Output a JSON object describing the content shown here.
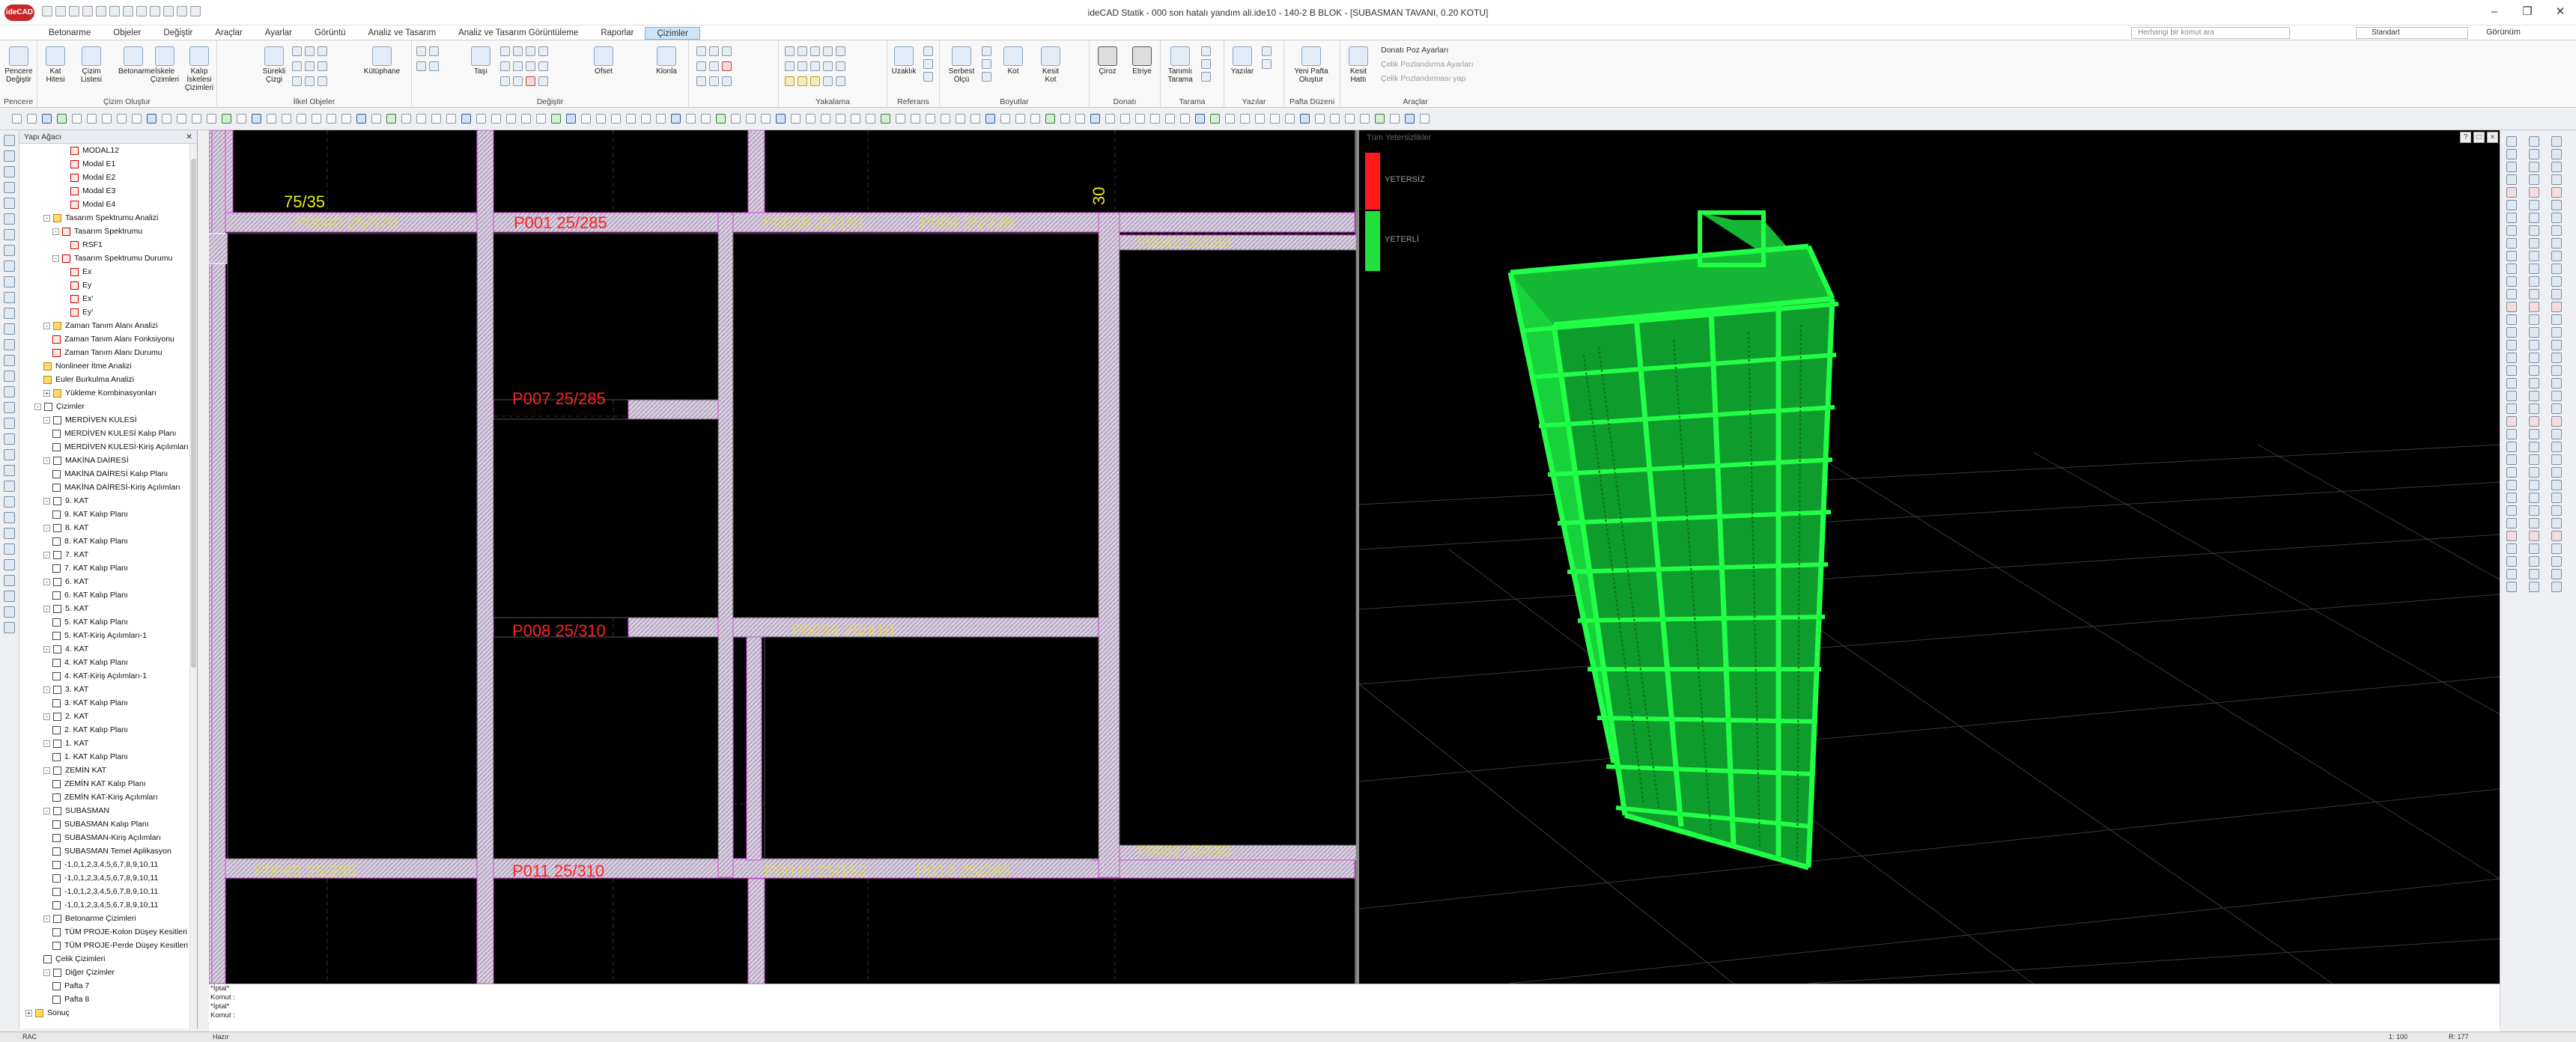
{
  "app": {
    "title": "ideCAD Statik - 000 son hatalı yandım ali.ide10 - 140-2 B BLOK - [SUBASMAN TAVANI,  0.20 KOTU]",
    "logo": "ideCAD"
  },
  "menus": [
    "Betonarme",
    "Objeler",
    "Değiştir",
    "Araçlar",
    "Ayarlar",
    "Görüntü",
    "Analiz ve Tasarım",
    "Analiz ve Tasarım Görüntüleme",
    "Raporlar",
    "Çizimler"
  ],
  "active_menu": "Çizimler",
  "search_placeholder": "Herhangi bir komut ara",
  "style_select": "Standart",
  "view_label": "Görünüm",
  "ribbon": {
    "groups": [
      {
        "title": "Pencere",
        "buttons": [
          "Pencere Değiştir"
        ]
      },
      {
        "title": "Çizim Oluştur",
        "buttons": [
          "Kat Hitesi",
          "Çizim Listesi",
          "Betonarme",
          "İskele Çizimleri",
          "Kalıp İskelesi Çizimleri"
        ]
      },
      {
        "title": "İlkel Objeler",
        "buttons": [
          "Sürekli Çizgi",
          "Kütüphane"
        ]
      },
      {
        "title": "Değiştir",
        "buttons": [
          "Taşı",
          "Ofset",
          "Klonla"
        ]
      },
      {
        "title": "Yakalama",
        "buttons": []
      },
      {
        "title": "Referans",
        "buttons": [
          "Uzaklık"
        ]
      },
      {
        "title": "Boyutlar",
        "buttons": [
          "Serbest Ölçü",
          "Kot",
          "Kesit Kot"
        ]
      },
      {
        "title": "Donatı",
        "buttons": [
          "Çiroz",
          "Etriye"
        ]
      },
      {
        "title": "Tarama",
        "buttons": [
          "Tanımlı Tarama"
        ]
      },
      {
        "title": "Yazılar",
        "buttons": [
          "Yazılar"
        ]
      },
      {
        "title": "Pafta Düzeni",
        "buttons": [
          "Yeni Pafta Oluştur"
        ]
      },
      {
        "title": "Araçlar",
        "buttons": [
          "Kesit Hattı"
        ]
      }
    ],
    "tools_list": [
      "Donatı Poz Ayarları",
      "Çelik Pozlandırma Ayarları",
      "Çelik Pozlandırması yap"
    ]
  },
  "tree": {
    "header": "Yapı Ağacı",
    "items": [
      {
        "label": "MODAL12",
        "level": 5,
        "icon": "red"
      },
      {
        "label": "Modal E1",
        "level": 5,
        "icon": "red"
      },
      {
        "label": "Modal E2",
        "level": 5,
        "icon": "red"
      },
      {
        "label": "Modal E3",
        "level": 5,
        "icon": "red"
      },
      {
        "label": "Modal E4",
        "level": 5,
        "icon": "red"
      },
      {
        "label": "Tasarım Spektrumu Analizi",
        "level": 2,
        "icon": "folder",
        "exp": "-"
      },
      {
        "label": "Tasarım Spektrumu",
        "level": 3,
        "icon": "red",
        "exp": "-"
      },
      {
        "label": "RSF1",
        "level": 5,
        "icon": "red"
      },
      {
        "label": "Tasarım Spektrumu Durumu",
        "level": 3,
        "icon": "red",
        "exp": "-"
      },
      {
        "label": "Ex",
        "level": 5,
        "icon": "red"
      },
      {
        "label": "Ey",
        "level": 5,
        "icon": "red"
      },
      {
        "label": "Ex'",
        "level": 5,
        "icon": "red"
      },
      {
        "label": "Ey'",
        "level": 5,
        "icon": "red"
      },
      {
        "label": "Zaman Tanım Alanı Analizi",
        "level": 2,
        "icon": "folder",
        "exp": "-"
      },
      {
        "label": "Zaman Tanım Alanı Fonksiyonu",
        "level": 3,
        "icon": "red"
      },
      {
        "label": "Zaman Tanım Alanı Durumu",
        "level": 3,
        "icon": "red"
      },
      {
        "label": "Nonlineer İtme Analizi",
        "level": 2,
        "icon": "folder"
      },
      {
        "label": "Euler Burkulma Analizi",
        "level": 2,
        "icon": "folder"
      },
      {
        "label": "Yükleme Kombinasyonları",
        "level": 2,
        "icon": "folder",
        "exp": "+"
      },
      {
        "label": "Çizimler",
        "level": 1,
        "icon": "doc",
        "exp": "-"
      },
      {
        "label": "MERDİVEN KULESİ",
        "level": 2,
        "icon": "doc",
        "exp": "-"
      },
      {
        "label": "MERDİVEN KULESİ Kalıp Planı",
        "level": 3,
        "icon": "doc"
      },
      {
        "label": "MERDİVEN KULESİ-Kiriş Açılımları",
        "level": 3,
        "icon": "doc"
      },
      {
        "label": "MAKİNA DAİRESİ",
        "level": 2,
        "icon": "doc",
        "exp": "-"
      },
      {
        "label": "MAKİNA DAİRESİ Kalıp Planı",
        "level": 3,
        "icon": "doc"
      },
      {
        "label": "MAKİNA DAİRESİ-Kiriş Açılımları",
        "level": 3,
        "icon": "doc"
      },
      {
        "label": "9. KAT",
        "level": 2,
        "icon": "doc",
        "exp": "-"
      },
      {
        "label": "9. KAT Kalıp Planı",
        "level": 3,
        "icon": "doc"
      },
      {
        "label": "8. KAT",
        "level": 2,
        "icon": "doc",
        "exp": "-"
      },
      {
        "label": "8. KAT Kalıp Planı",
        "level": 3,
        "icon": "doc"
      },
      {
        "label": "7. KAT",
        "level": 2,
        "icon": "doc",
        "exp": "-"
      },
      {
        "label": "7. KAT Kalıp Planı",
        "level": 3,
        "icon": "doc"
      },
      {
        "label": "6. KAT",
        "level": 2,
        "icon": "doc",
        "exp": "-"
      },
      {
        "label": "6. KAT Kalıp Planı",
        "level": 3,
        "icon": "doc"
      },
      {
        "label": "5. KAT",
        "level": 2,
        "icon": "doc",
        "exp": "-"
      },
      {
        "label": "5. KAT Kalıp Planı",
        "level": 3,
        "icon": "doc"
      },
      {
        "label": "5. KAT-Kiriş Açılımları-1",
        "level": 3,
        "icon": "doc"
      },
      {
        "label": "4. KAT",
        "level": 2,
        "icon": "doc",
        "exp": "-"
      },
      {
        "label": "4. KAT Kalıp Planı",
        "level": 3,
        "icon": "doc"
      },
      {
        "label": "4. KAT-Kiriş Açılımları-1",
        "level": 3,
        "icon": "doc"
      },
      {
        "label": "3. KAT",
        "level": 2,
        "icon": "doc",
        "exp": "-"
      },
      {
        "label": "3. KAT Kalıp Planı",
        "level": 3,
        "icon": "doc"
      },
      {
        "label": "2. KAT",
        "level": 2,
        "icon": "doc",
        "exp": "-"
      },
      {
        "label": "2. KAT Kalıp Planı",
        "level": 3,
        "icon": "doc"
      },
      {
        "label": "1. KAT",
        "level": 2,
        "icon": "doc",
        "exp": "-"
      },
      {
        "label": "1. KAT Kalıp Planı",
        "level": 3,
        "icon": "doc"
      },
      {
        "label": "ZEMİN KAT",
        "level": 2,
        "icon": "doc",
        "exp": "-"
      },
      {
        "label": "ZEMİN KAT Kalıp Planı",
        "level": 3,
        "icon": "doc"
      },
      {
        "label": "ZEMİN KAT-Kiriş Açılımları",
        "level": 3,
        "icon": "doc"
      },
      {
        "label": "SUBASMAN",
        "level": 2,
        "icon": "doc",
        "exp": "-"
      },
      {
        "label": "SUBASMAN Kalıp Planı",
        "level": 3,
        "icon": "doc"
      },
      {
        "label": "SUBASMAN-Kiriş Açılımları",
        "level": 3,
        "icon": "doc"
      },
      {
        "label": "SUBASMAN Temel Aplikasyon",
        "level": 3,
        "icon": "doc"
      },
      {
        "label": "-1,0,1,2,3,4,5,6,7,8,9,10,11",
        "level": 3,
        "icon": "doc"
      },
      {
        "label": "-1,0,1,2,3,4,5,6,7,8,9,10,11",
        "level": 3,
        "icon": "doc"
      },
      {
        "label": "-1,0,1,2,3,4,5,6,7,8,9,10,11",
        "level": 3,
        "icon": "doc"
      },
      {
        "label": "-1,0,1,2,3,4,5,6,7,8,9,10,11",
        "level": 3,
        "icon": "doc"
      },
      {
        "label": "Betonarme Çizimleri",
        "level": 2,
        "icon": "doc",
        "exp": "-"
      },
      {
        "label": "TÜM PROJE-Kolon Düşey Kesitleri",
        "level": 3,
        "icon": "doc"
      },
      {
        "label": "TÜM PROJE-Perde Düşey Kesitleri",
        "level": 3,
        "icon": "doc"
      },
      {
        "label": "Çelik Çizimleri",
        "level": 2,
        "icon": "doc"
      },
      {
        "label": "Diğer Çizimler",
        "level": 2,
        "icon": "doc",
        "exp": "-"
      },
      {
        "label": "Pafta 7",
        "level": 3,
        "icon": "doc"
      },
      {
        "label": "Pafta 8",
        "level": 3,
        "icon": "doc"
      },
      {
        "label": "Sonuç",
        "level": 0,
        "icon": "folder",
        "exp": "+"
      }
    ]
  },
  "plan": {
    "labels_red": [
      "P001 25/285",
      "P007 25/285",
      "P008 25/310",
      "P011 25/310"
    ],
    "labels_yellow": [
      "75/35",
      "P0040 25/370",
      "P0038 25/181",
      "P004 25/228",
      "P0042 25/550",
      "P0039 25/410",
      "P0043 25/285",
      "P0044 25/152",
      "P012 25/285",
      "P0052 25/550",
      "30"
    ]
  },
  "view3d": {
    "legend_title": "Tüm Yetersizlikler",
    "legend": [
      {
        "label": "YETERSİZ",
        "color": "#ff1a1a"
      },
      {
        "label": "YETERLİ",
        "color": "#20e03c"
      }
    ],
    "controls": [
      "?",
      "□",
      "×"
    ]
  },
  "command": {
    "lines": [
      "*İptal*",
      "Komut :",
      "*İptal*",
      "Komut :"
    ]
  },
  "status": {
    "left": "RAC",
    "mid": "Hazır",
    "right1": "1: 100",
    "right2": "R: 177"
  }
}
